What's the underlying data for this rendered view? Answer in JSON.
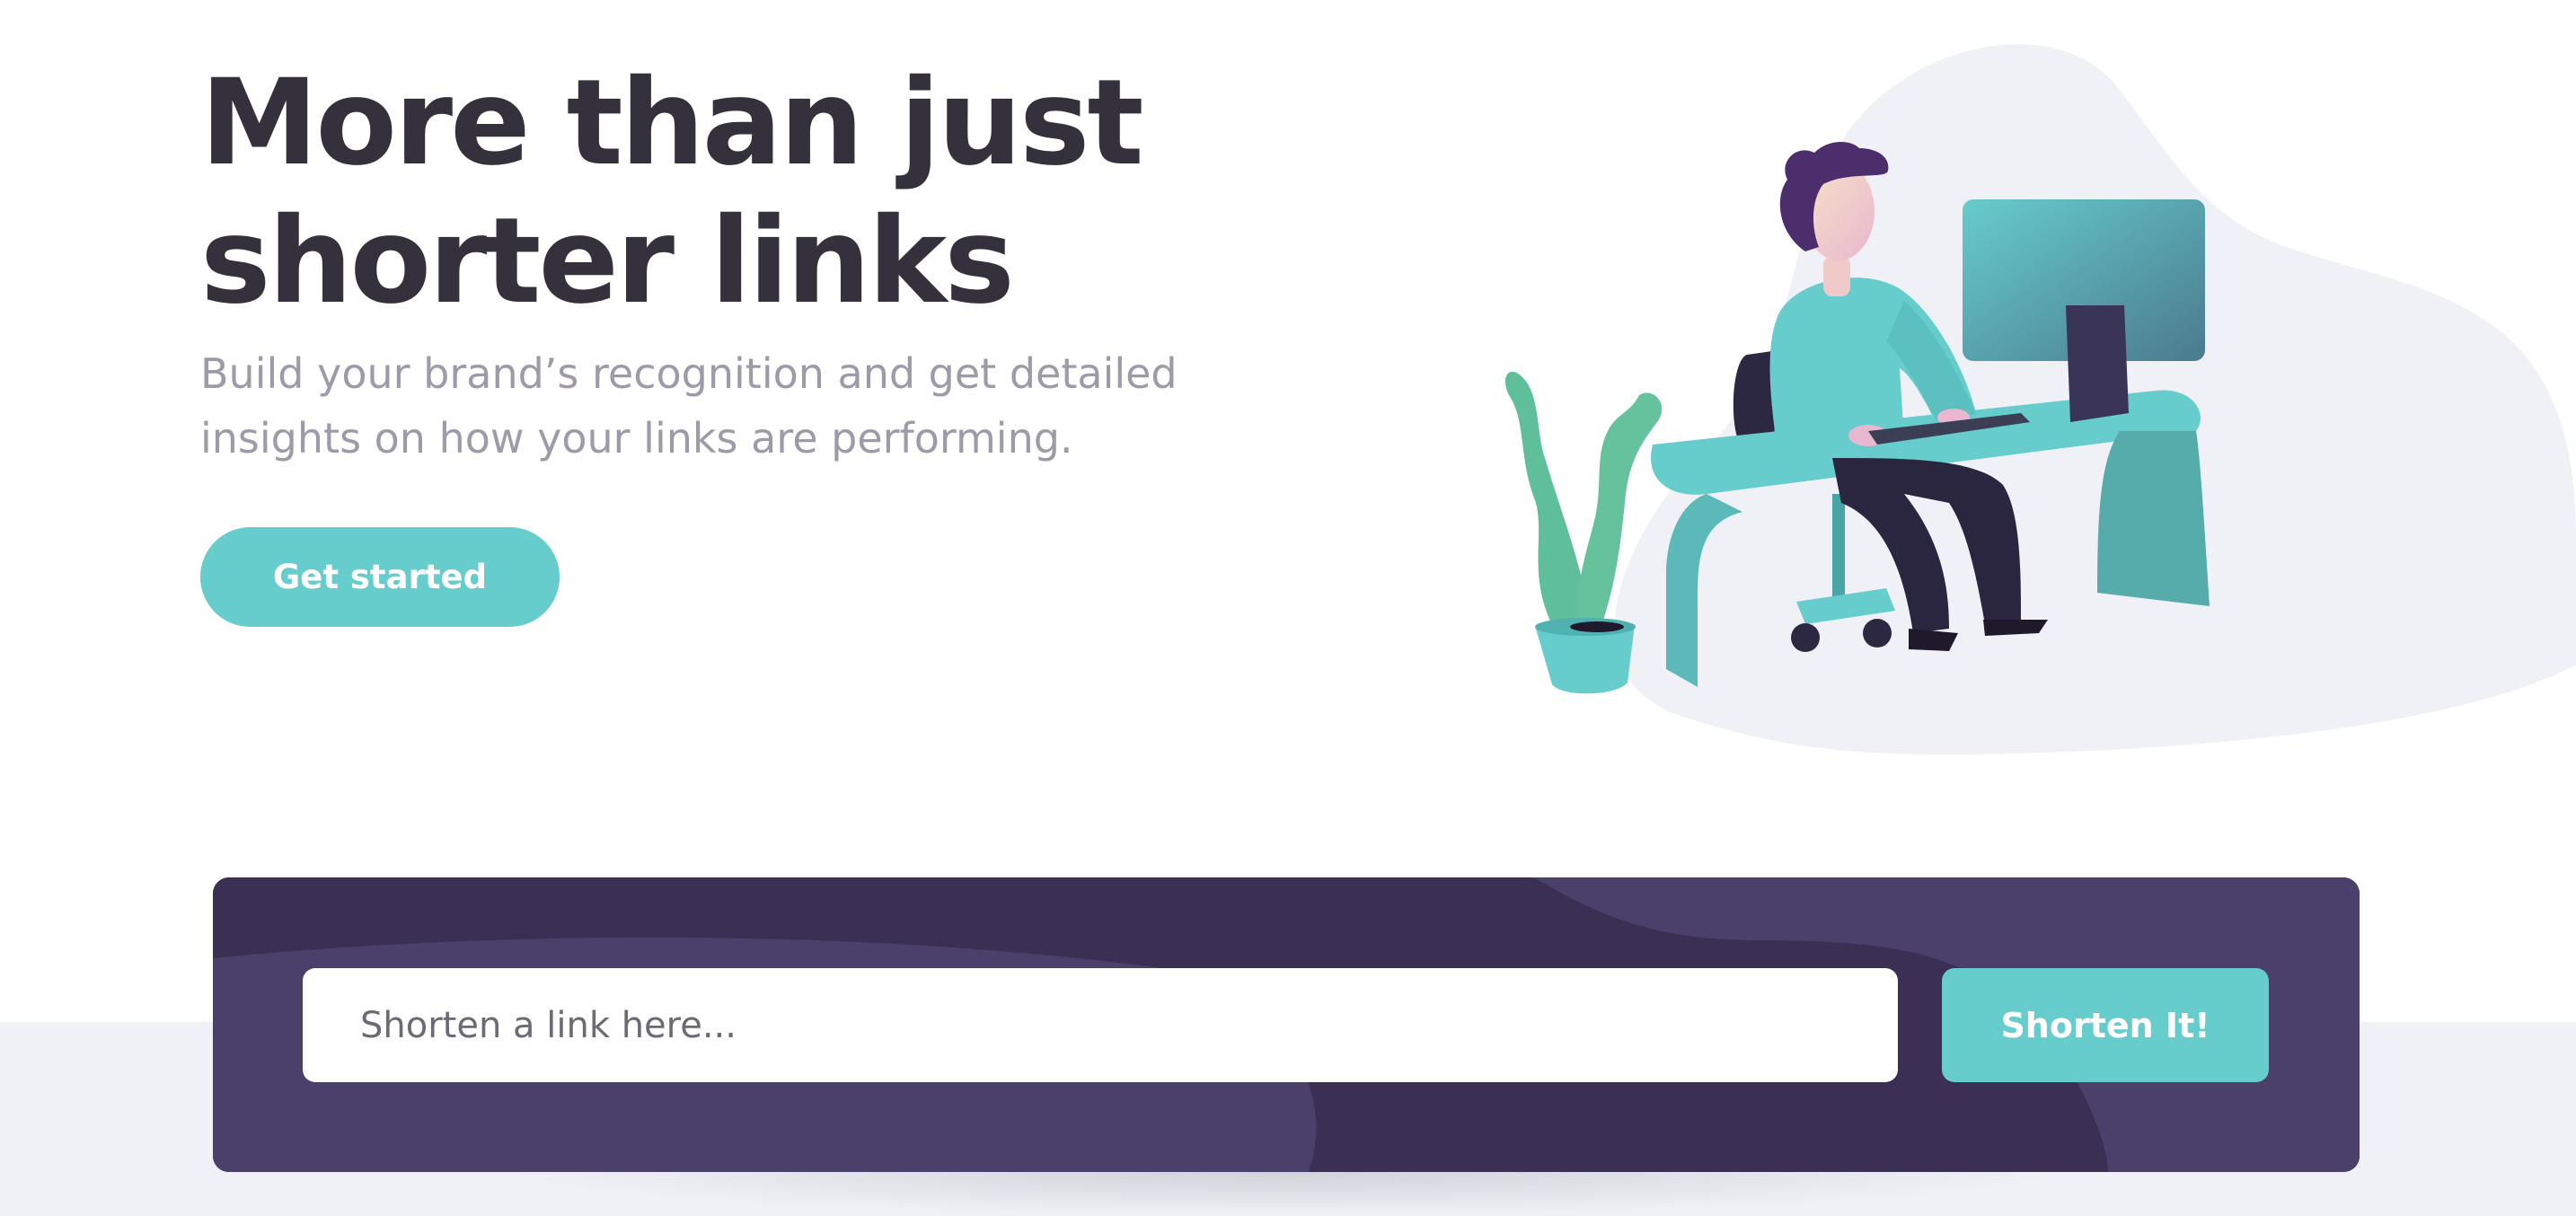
{
  "hero": {
    "title_line1": "More than just",
    "title_line2": "shorter links",
    "subtitle_line1": "Build your brand’s recognition and get detailed",
    "subtitle_line2": "insights on how your links are performing.",
    "cta_label": "Get started"
  },
  "shortener": {
    "placeholder": "Shorten a link here...",
    "button_label": "Shorten It!"
  },
  "illustration": {
    "icon": "person-working-at-desk-illustration"
  },
  "colors": {
    "primary_cyan": "#66cccc",
    "dark_violet": "#3b3054",
    "violet_light": "#4b3f6b",
    "heading_text": "#34313d",
    "body_gray": "#9e9aa8",
    "band_gray": "#f0f1f6"
  }
}
